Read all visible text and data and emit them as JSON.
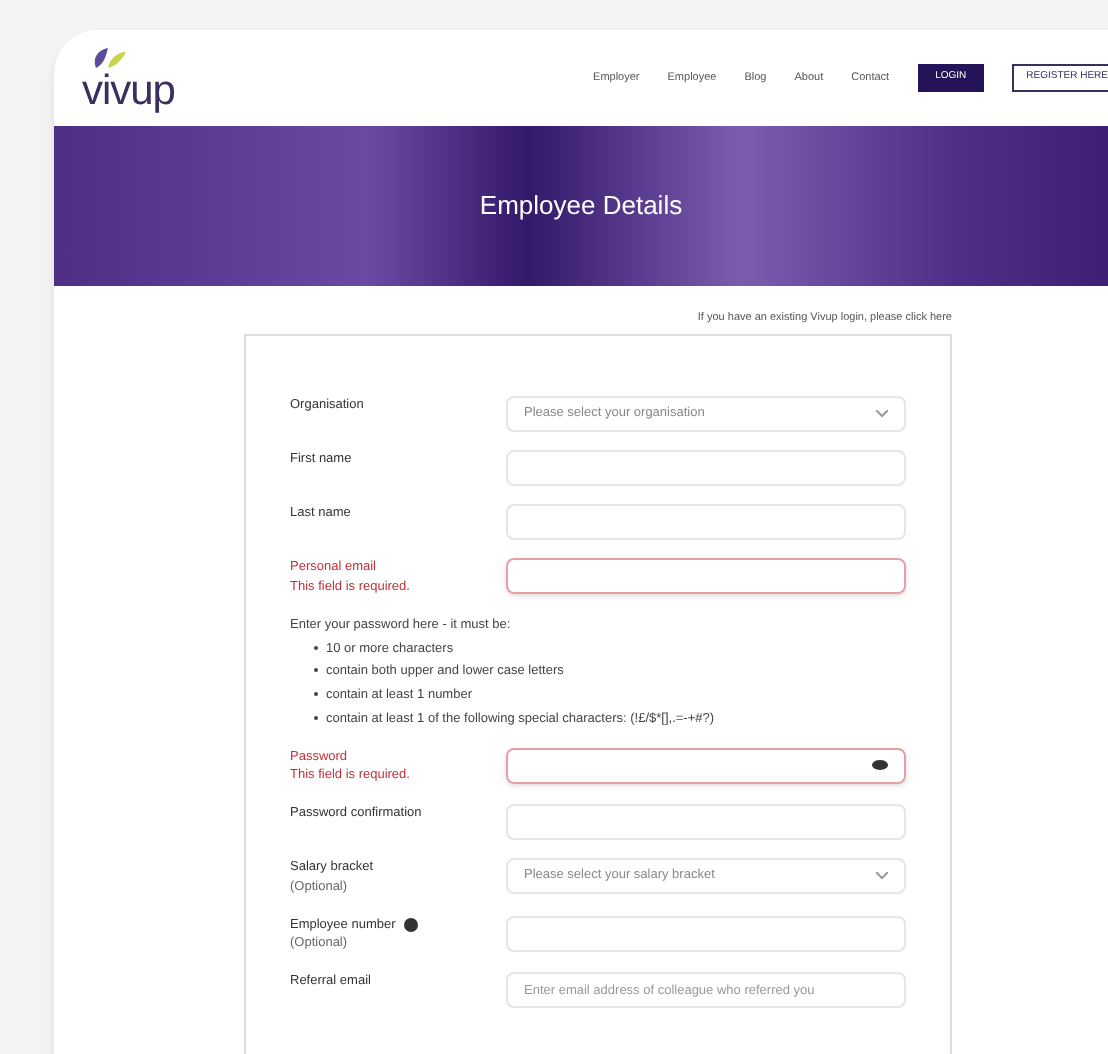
{
  "header": {
    "logo": "vivup",
    "nav": [
      "Employer",
      "Employee",
      "Blog",
      "About",
      "Contact"
    ],
    "login_button": "LOGIN",
    "register_button": "REGISTER HERE"
  },
  "banner": {
    "title": "Employee Details"
  },
  "login_hint": "If you have an existing Vivup login, please click here",
  "form": {
    "fields": [
      {
        "kind": "select",
        "label": "Organisation",
        "placeholder": "Please select your organisation"
      },
      {
        "kind": "text",
        "label": "First name"
      },
      {
        "kind": "text",
        "label": "Last name"
      },
      {
        "kind": "text",
        "label": "Personal email",
        "error": "This field is required."
      },
      {
        "kind": "rules",
        "intro": "Enter your password here - it must be:",
        "rules": [
          "10 or more characters",
          "contain both upper and lower case letters",
          "contain at least 1 number",
          "contain at least 1 of the following special characters: (!£/$*[],.=-+#?)"
        ]
      },
      {
        "kind": "password",
        "label": "Password",
        "error": "This field is required."
      },
      {
        "kind": "text",
        "label": "Password confirmation"
      },
      {
        "kind": "select",
        "label": "Salary bracket",
        "note": "(Optional)",
        "placeholder": "Please select your salary bracket"
      },
      {
        "kind": "text",
        "label": "Employee number",
        "note": "(Optional)",
        "info": true
      },
      {
        "kind": "text",
        "label": "Referral email",
        "placeholder": "Enter email address of colleague who referred you"
      }
    ]
  }
}
